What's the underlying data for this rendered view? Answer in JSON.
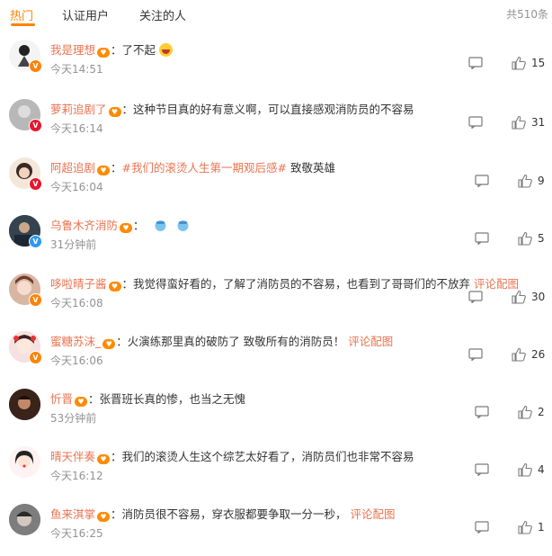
{
  "tabs": [
    {
      "label": "热门"
    },
    {
      "label": "认证用户"
    },
    {
      "label": "关注的人"
    }
  ],
  "total_label": "共510条",
  "colors": {
    "accent": "#ff8200",
    "username": "#eb7350",
    "muted": "#939393"
  },
  "comments": [
    {
      "username": "我是理想",
      "colon": "：",
      "text": "了不起",
      "time": "今天14:51",
      "likes": "15",
      "badge": "orange"
    },
    {
      "username": "萝莉追剧了",
      "colon": "：",
      "text": "这种节目真的好有意义啊，可以直接感观消防员的不容易",
      "time": "今天16:14",
      "likes": "31",
      "badge": "red"
    },
    {
      "username": "阿超追剧",
      "colon": "：",
      "topic": "#我们的滚烫人生第一期观后感#",
      "text": " 致敬英雄",
      "time": "今天16:04",
      "likes": "9",
      "badge": "red"
    },
    {
      "username": "乌鲁木齐消防",
      "colon": "：",
      "time": "31分钟前",
      "likes": "5",
      "badge": "blue"
    },
    {
      "username": "哆啦晴子酱",
      "colon": "：",
      "text": "我觉得蛮好看的，了解了消防员的不容易，也看到了哥哥们的不放弃 ",
      "pic_link": "评论配图",
      "time": "今天16:08",
      "likes": "30",
      "badge": "orange"
    },
    {
      "username": "蜜糖苏沫_",
      "colon": "：",
      "text": "火演练那里真的破防了 致敬所有的消防员！ ",
      "pic_link": "评论配图",
      "time": "今天16:06",
      "likes": "26",
      "badge": "orange"
    },
    {
      "username": "忻晋",
      "colon": "：",
      "text": "张晋班长真的惨，也当之无愧",
      "time": "53分钟前",
      "likes": "2"
    },
    {
      "username": "晴天伴奏",
      "colon": "：",
      "text": "我们的滚烫人生这个综艺太好看了，消防员们也非常不容易",
      "time": "今天16:12",
      "likes": "4"
    },
    {
      "username": "鱼来淇掌",
      "colon": "：",
      "text": "消防员很不容易，穿衣服都要争取一分一秒， ",
      "pic_link": "评论配图",
      "time": "今天16:25",
      "likes": "1"
    }
  ]
}
